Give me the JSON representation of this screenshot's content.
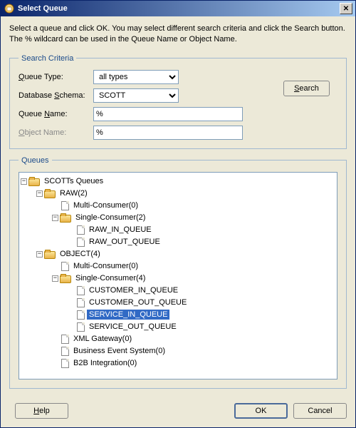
{
  "window": {
    "title": "Select Queue"
  },
  "instructions": "Select a queue and click OK. You may select different search criteria and click the Search button. The % wildcard can be used in the Queue Name or Object Name.",
  "criteriaLegend": "Search Criteria",
  "queuesLegend": "Queues",
  "labels": {
    "queueType": "Queue Type:",
    "schema": "Database Schema:",
    "queueName": "Queue Name:",
    "objectName": "Object Name:",
    "search": "Search",
    "help": "Help",
    "ok": "OK",
    "cancel": "Cancel"
  },
  "criteria": {
    "queueType": "all types",
    "schema": "SCOTT",
    "queueName": "%",
    "objectName": "%"
  },
  "tree": {
    "root": "SCOTTs Queues",
    "raw": "RAW(2)",
    "rawMulti": "Multi-Consumer(0)",
    "rawSingle": "Single-Consumer(2)",
    "rawIn": "RAW_IN_QUEUE",
    "rawOut": "RAW_OUT_QUEUE",
    "object": "OBJECT(4)",
    "objMulti": "Multi-Consumer(0)",
    "objSingle": "Single-Consumer(4)",
    "custIn": "CUSTOMER_IN_QUEUE",
    "custOut": "CUSTOMER_OUT_QUEUE",
    "servIn": "SERVICE_IN_QUEUE",
    "servOut": "SERVICE_OUT_QUEUE",
    "xml": "XML Gateway(0)",
    "bes": "Business Event System(0)",
    "b2b": "B2B Integration(0)"
  }
}
